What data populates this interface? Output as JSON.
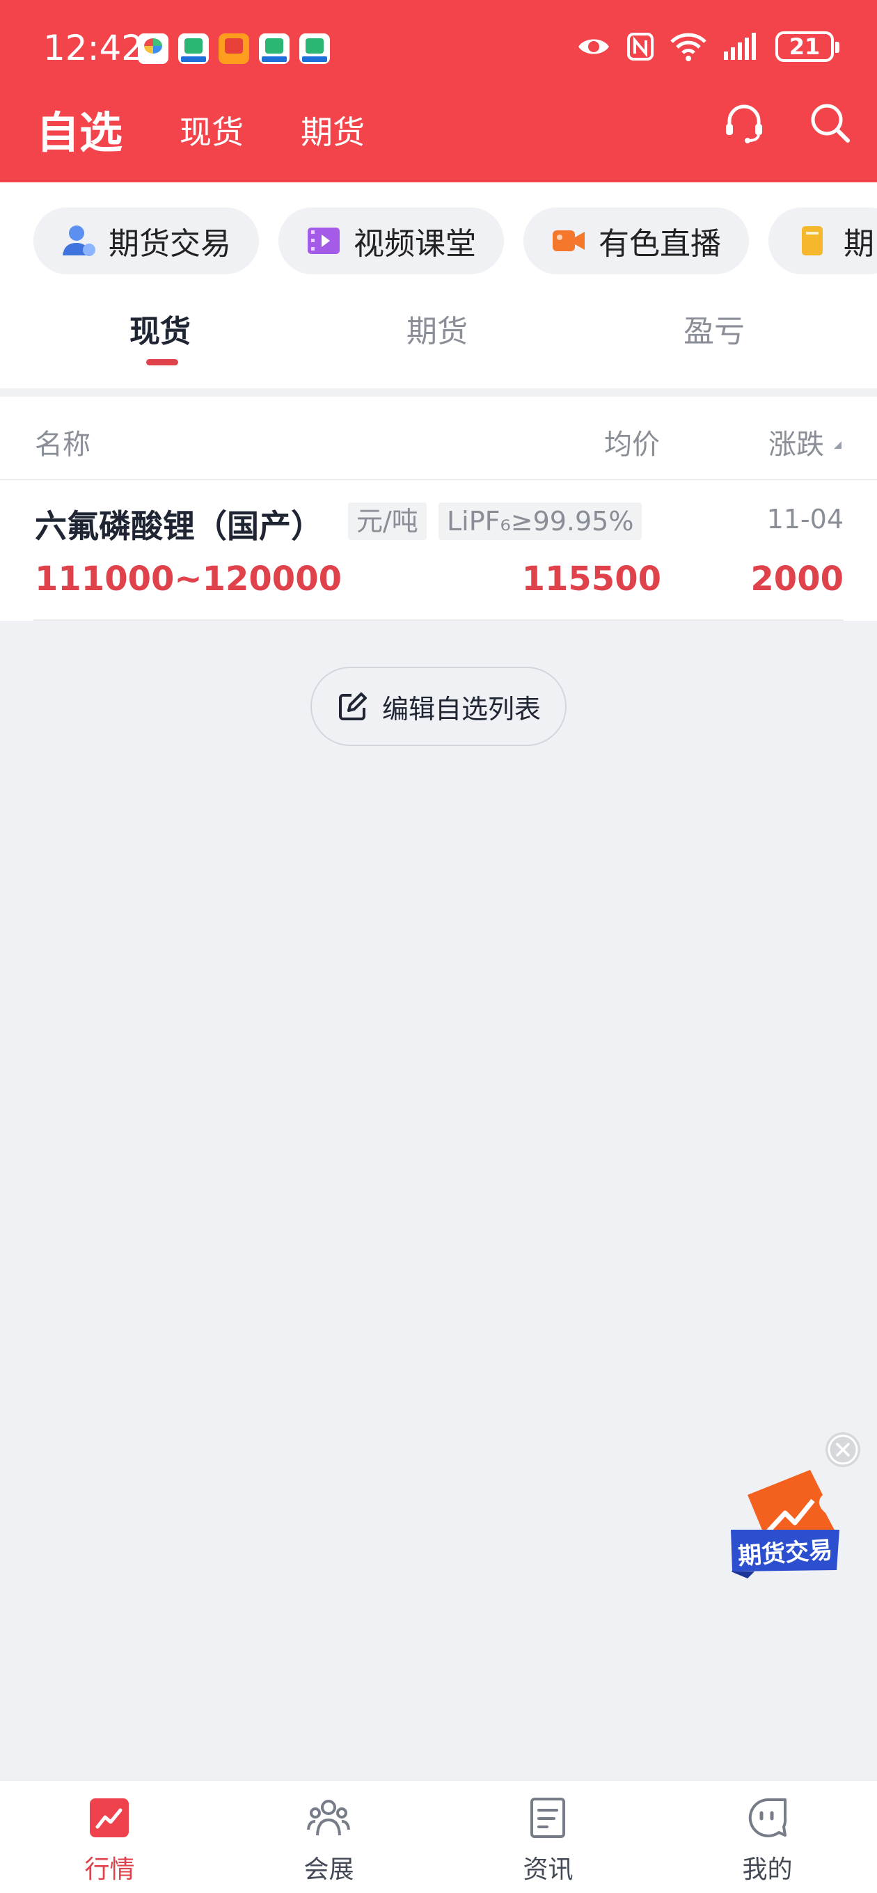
{
  "status_bar": {
    "time": "12:42",
    "battery": "21",
    "notification_icons": [
      "app-icon",
      "video-app-icon",
      "red-envelope-icon",
      "video-app-icon",
      "video-app-icon"
    ],
    "right_icons": [
      "eye-icon",
      "nfc-icon",
      "wifi-icon",
      "signal-icon",
      "battery-icon"
    ]
  },
  "header": {
    "title": "自选",
    "tabs": [
      "现货",
      "期货"
    ],
    "icons": [
      "headset-icon",
      "search-icon"
    ],
    "background": "#f3434b"
  },
  "shortcuts": [
    {
      "label": "期货交易",
      "icon": "user-icon"
    },
    {
      "label": "视频课堂",
      "icon": "film-icon"
    },
    {
      "label": "有色直播",
      "icon": "camera-icon"
    },
    {
      "label": "期",
      "icon": "document-icon"
    }
  ],
  "sub_tabs": {
    "items": [
      "现货",
      "期货",
      "盈亏"
    ],
    "active": "现货"
  },
  "table": {
    "headers": {
      "name": "名称",
      "avg": "均价",
      "change": "涨跌"
    },
    "rows": [
      {
        "name": "六氟磷酸锂（国产）",
        "unit": "元/吨",
        "spec": "LiPF₆≥99.95%",
        "date": "11-04",
        "range": "111000~120000",
        "avg": "115500",
        "change": "2000"
      }
    ]
  },
  "edit_button": {
    "label": "编辑自选列表",
    "icon": "edit-icon"
  },
  "floating_ad": {
    "label": "期货交易"
  },
  "bottom_nav": {
    "items": [
      {
        "label": "行情",
        "icon": "chart-icon",
        "active": true
      },
      {
        "label": "会展",
        "icon": "people-icon",
        "active": false
      },
      {
        "label": "资讯",
        "icon": "news-icon",
        "active": false
      },
      {
        "label": "我的",
        "icon": "profile-icon",
        "active": false
      }
    ]
  },
  "colors": {
    "accent_red": "#e0424c",
    "header_red": "#f3434b",
    "background": "#f0f1f4",
    "text_dark": "#1f2533",
    "text_gray": "#8a8e97"
  }
}
